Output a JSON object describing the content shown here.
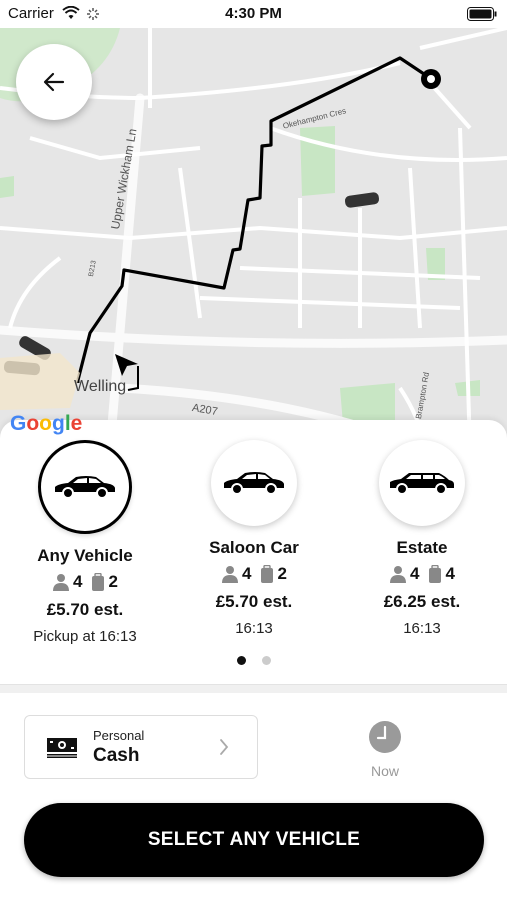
{
  "status_bar": {
    "carrier": "Carrier",
    "time": "4:30 PM"
  },
  "map": {
    "google_logo": "Google",
    "labels": {
      "town": "Welling",
      "road_upper_wickham": "Upper Wickham Ln",
      "road_a207": "A207",
      "road_top": "Okehampton Cres",
      "road_right": "Brampton Rd",
      "road_small": "B213"
    }
  },
  "vehicles": [
    {
      "name": "Any Vehicle",
      "passengers": "4",
      "luggage": "2",
      "price": "£5.70 est.",
      "pickup": "Pickup at 16:13",
      "selected": true
    },
    {
      "name": "Saloon Car",
      "passengers": "4",
      "luggage": "2",
      "price": "£5.70 est.",
      "pickup": "16:13",
      "selected": false
    },
    {
      "name": "Estate",
      "passengers": "4",
      "luggage": "4",
      "price": "£6.25 est.",
      "pickup": "16:13",
      "selected": false
    }
  ],
  "pagination": {
    "pages": 2,
    "current": 1
  },
  "payment": {
    "type": "Personal",
    "method": "Cash"
  },
  "schedule": {
    "label": "Now"
  },
  "cta": {
    "label": "SELECT ANY VEHICLE"
  },
  "colors": {
    "primary": "#000000",
    "map_bg": "#e6e6e6",
    "park_green": "#c8e6c4",
    "inactive_dot": "#cccccc"
  },
  "icons": {
    "back": "arrow-left-icon",
    "destination": "destination-pin-icon",
    "passenger": "person-icon",
    "luggage": "suitcase-icon",
    "cash": "banknote-icon",
    "chevron": "chevron-right-icon",
    "clock": "clock-icon"
  }
}
